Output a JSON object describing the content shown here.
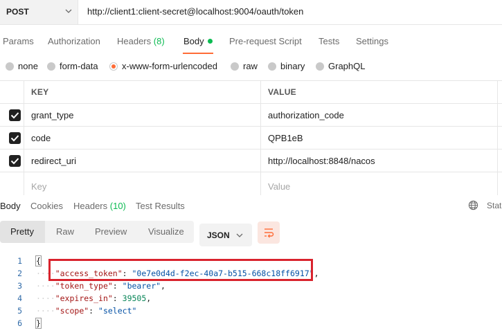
{
  "request": {
    "method": "POST",
    "url": "http://client1:client-secret@localhost:9004/oauth/token"
  },
  "tabs": [
    {
      "label": "Params"
    },
    {
      "label": "Authorization"
    },
    {
      "label": "Headers",
      "count": "(8)"
    },
    {
      "label": "Body"
    },
    {
      "label": "Pre-request Script"
    },
    {
      "label": "Tests"
    },
    {
      "label": "Settings"
    }
  ],
  "body_types": [
    "none",
    "form-data",
    "x-www-form-urlencoded",
    "raw",
    "binary",
    "GraphQL"
  ],
  "body_type_selected": "x-www-form-urlencoded",
  "kv_table": {
    "headers": {
      "key": "KEY",
      "value": "VALUE"
    },
    "rows": [
      {
        "key": "grant_type",
        "value": "authorization_code",
        "checked": true
      },
      {
        "key": "code",
        "value": "QPB1eB",
        "checked": true
      },
      {
        "key": "redirect_uri",
        "value": "http://localhost:8848/nacos",
        "checked": true
      }
    ],
    "placeholder": {
      "key": "Key",
      "value": "Value"
    }
  },
  "response_tabs": [
    {
      "label": "Body"
    },
    {
      "label": "Cookies"
    },
    {
      "label": "Headers",
      "count": "(10)"
    },
    {
      "label": "Test Results"
    }
  ],
  "status_partial": "Stat",
  "view_modes": [
    "Pretty",
    "Raw",
    "Preview",
    "Visualize"
  ],
  "view_mode_selected": "Pretty",
  "format": "JSON",
  "code_lines": {
    "l1": "{",
    "l2_key": "\"access_token\"",
    "l2_val": "\"0e7e0d4d-f2ec-40a7-b515-668c18ff6917\"",
    "l3_key": "\"token_type\"",
    "l3_val": "\"bearer\"",
    "l4_key": "\"expires_in\"",
    "l4_val": "39505",
    "l5_key": "\"scope\"",
    "l5_val": "\"select\"",
    "l6": "}"
  },
  "line_numbers": [
    "1",
    "2",
    "3",
    "4",
    "5",
    "6"
  ],
  "colors": {
    "accent": "#ff6c37",
    "count_green": "#0cbb52",
    "annotation_red": "#d9232d"
  }
}
